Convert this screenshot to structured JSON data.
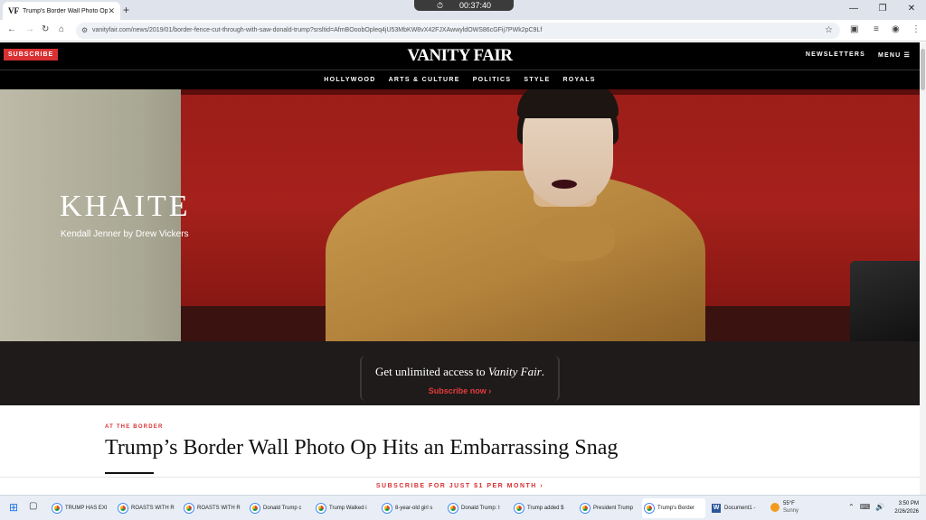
{
  "browser": {
    "tab_title": "Trump's Border Wall Photo Op",
    "tab_favicon": "VF",
    "timer": "00:37:40",
    "url": "vanityfair.com/news/2019/01/border-fence-cut-through-with-saw-donald-trump?srsltid=AfmBOoobOpleq4jU53MbKW8vX42FJXAwwyldOWS86cGFij7PWk2pC9Lf"
  },
  "site": {
    "subscribe_label": "SUBSCRIBE",
    "logo": "VANITY FAIR",
    "newsletters_label": "NEWSLETTERS",
    "menu_label": "MENU ☰",
    "nav": [
      "HOLLYWOOD",
      "ARTS & CULTURE",
      "POLITICS",
      "STYLE",
      "ROYALS"
    ]
  },
  "ad": {
    "brand": "KHAITE",
    "credit": "Kendall Jenner by Drew Vickers"
  },
  "promo": {
    "text_prefix": "Get unlimited access to ",
    "text_italic": "Vanity Fair",
    "text_suffix": ".",
    "link": "Subscribe now ›"
  },
  "article": {
    "kicker": "AT THE BORDER",
    "headline": "Trump’s Border Wall Photo Op Hits an Embarrassing Snag"
  },
  "sub_banner": "SUBSCRIBE FOR JUST $1 PER MONTH  ›",
  "taskbar": {
    "items": [
      {
        "label": "TRUMP HAS EXI",
        "icon": "chrome-icon"
      },
      {
        "label": "ROASTS WITH R",
        "icon": "chrome-icon"
      },
      {
        "label": "ROASTS WITH R",
        "icon": "chrome-icon"
      },
      {
        "label": "Donald Trump c",
        "icon": "chrome-icon"
      },
      {
        "label": "Trump Walked i",
        "icon": "chrome-icon"
      },
      {
        "label": "8-year-old girl s",
        "icon": "chrome-icon"
      },
      {
        "label": "Donald Trump: I",
        "icon": "chrome-icon"
      },
      {
        "label": "Trump added $",
        "icon": "chrome-icon"
      },
      {
        "label": "President Trump",
        "icon": "chrome-icon"
      },
      {
        "label": "Trump's Border",
        "icon": "chrome-icon"
      },
      {
        "label": "Document1 -",
        "icon": "word-icon"
      }
    ],
    "weather_temp": "55°F",
    "weather_desc": "Sunny",
    "time": "3:50 PM",
    "date": "2/26/2026"
  },
  "colors": {
    "accent_red": "#d93032",
    "header_black": "#000000",
    "promo_bg": "#1f1b1b"
  }
}
